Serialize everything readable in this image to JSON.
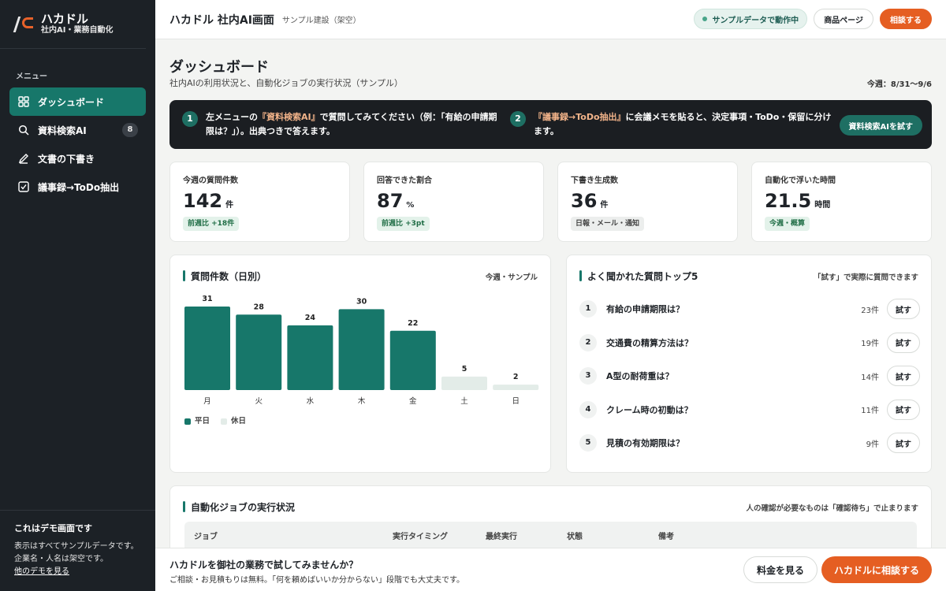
{
  "brand": {
    "name": "ハカドル",
    "tagline": "社内AI・業務自動化"
  },
  "sidebar": {
    "menu_label": "メニュー",
    "items": [
      {
        "label": "ダッシュボード",
        "icon": "grid-icon"
      },
      {
        "label": "資料検索AI",
        "icon": "search-icon",
        "badge": "8"
      },
      {
        "label": "文書の下書き",
        "icon": "pen-icon"
      },
      {
        "label": "議事録→ToDo抽出",
        "icon": "checkbox-icon"
      }
    ],
    "footer": {
      "title": "これはデモ画面です",
      "desc": "表示はすべてサンプルデータです。企業名・人名は架空です。",
      "link": "他のデモを見る"
    }
  },
  "header": {
    "title": "ハカドル 社内AI画面",
    "company": "サンプル建設（架空）",
    "status": "サンプルデータで動作中",
    "product_btn": "商品ページ",
    "consult_btn": "相談する"
  },
  "page": {
    "title": "ダッシュボード",
    "subtitle": "社内AIの利用状況と、自動化ジョブの実行状況（サンプル）",
    "week": "今週：8/31〜9/6"
  },
  "banner": {
    "step1_num": "1",
    "step1_pre": "左メニューの",
    "step1_hl": "『資料検索AI』",
    "step1_post": "で質問してみてください（例：「有給の申請期限は？」）。出典つきで答えます。",
    "step2_num": "2",
    "step2_hl": "『議事録→ToDo抽出』",
    "step2_post": "に会議メモを貼ると、決定事項・ToDo・保留に分けます。",
    "button": "資料検索AIを試す"
  },
  "kpis": [
    {
      "label": "今週の質問件数",
      "value": "142",
      "unit": "件",
      "badge": "前週比 +18件",
      "badge_style": "green"
    },
    {
      "label": "回答できた割合",
      "value": "87",
      "unit": "%",
      "badge": "前週比 +3pt",
      "badge_style": "green"
    },
    {
      "label": "下書き生成数",
      "value": "36",
      "unit": "件",
      "badge": "日報・メール・通知",
      "badge_style": "gray"
    },
    {
      "label": "自動化で浮いた時間",
      "value": "21.5",
      "unit": "時間",
      "badge": "今週・概算",
      "badge_style": "green"
    }
  ],
  "chart_card": {
    "title": "質問件数（日別）",
    "note": "今週・サンプル",
    "legend_weekday": "平日",
    "legend_holiday": "休日"
  },
  "chart_data": {
    "type": "bar",
    "categories": [
      "月",
      "火",
      "水",
      "木",
      "金",
      "土",
      "日"
    ],
    "values": [
      31,
      28,
      24,
      30,
      22,
      5,
      2
    ],
    "series_kind": [
      "平日",
      "平日",
      "平日",
      "平日",
      "平日",
      "休日",
      "休日"
    ],
    "colors": {
      "weekday": "#17776a",
      "holiday": "#e3ece8"
    },
    "ylim": [
      0,
      31
    ]
  },
  "top5": {
    "title": "よく聞かれた質問トップ5",
    "note": "「試す」で実際に質問できます",
    "try_label": "試す",
    "items": [
      {
        "num": "1",
        "q": "有給の申請期限は？",
        "count": "23件"
      },
      {
        "num": "2",
        "q": "交通費の精算方法は？",
        "count": "19件"
      },
      {
        "num": "3",
        "q": "A型の耐荷重は？",
        "count": "14件"
      },
      {
        "num": "4",
        "q": "クレーム時の初動は？",
        "count": "11件"
      },
      {
        "num": "5",
        "q": "見積の有効期限は？",
        "count": "9件"
      }
    ]
  },
  "jobs": {
    "title": "自動化ジョブの実行状況",
    "note": "人の確認が必要なものは「確認待ち」で止まります",
    "columns": [
      "ジョブ",
      "実行タイミング",
      "最終実行",
      "状態",
      "備考"
    ]
  },
  "cta": {
    "title": "ハカドルを御社の業務で試してみませんか？",
    "sub": "ご相談・お見積もりは無料。「何を頼めばいいか分からない」段階でも大丈夫です。",
    "price_btn": "料金を見る",
    "consult_btn": "ハカドルに相談する"
  }
}
